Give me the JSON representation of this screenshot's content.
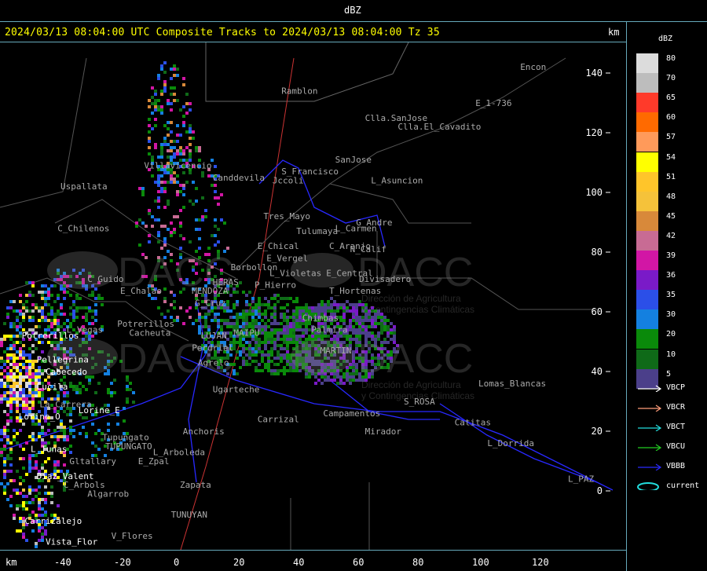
{
  "header": {
    "title": "dBZ"
  },
  "subtitle": {
    "text": "2024/03/13 08:04:00 UTC Composite Tracks to 2024/03/13 08:04:00 Tz 35",
    "unit": "km"
  },
  "axes": {
    "x_unit": "km",
    "x_ticks": [
      "-40",
      "-20",
      "0",
      "20",
      "40",
      "60",
      "80",
      "100",
      "120"
    ],
    "y_ticks": [
      "140",
      "120",
      "100",
      "80",
      "60",
      "40",
      "20",
      "0"
    ]
  },
  "legend": {
    "title": "dBZ",
    "scale": [
      {
        "label": "80",
        "color": "#dcdcdc"
      },
      {
        "label": "70",
        "color": "#bdbdbd"
      },
      {
        "label": "65",
        "color": "#ff3a2a"
      },
      {
        "label": "60",
        "color": "#ff6a00"
      },
      {
        "label": "57",
        "color": "#ff9a5a"
      },
      {
        "label": "54",
        "color": "#ffff00"
      },
      {
        "label": "51",
        "color": "#ffc52a"
      },
      {
        "label": "48",
        "color": "#f5c23a"
      },
      {
        "label": "45",
        "color": "#d8893a"
      },
      {
        "label": "42",
        "color": "#c86b94"
      },
      {
        "label": "39",
        "color": "#d216a5"
      },
      {
        "label": "36",
        "color": "#7a1ac8"
      },
      {
        "label": "35",
        "color": "#2b4fe8"
      },
      {
        "label": "30",
        "color": "#1480e0"
      },
      {
        "label": "20",
        "color": "#0a8a0a"
      },
      {
        "label": "10",
        "color": "#0f6a18"
      },
      {
        "label": "5",
        "color": "#4b3f8a"
      }
    ],
    "tracks": [
      {
        "label": "VBCP",
        "color": "#ffffff"
      },
      {
        "label": "VBCR",
        "color": "#ff9c7a"
      },
      {
        "label": "VBCT",
        "color": "#22dddd"
      },
      {
        "label": "VBCU",
        "color": "#22cc22"
      },
      {
        "label": "VBBB",
        "color": "#2a2aff"
      },
      {
        "label": "current",
        "color": "#22dddd"
      }
    ]
  },
  "watermark": {
    "logo_text": "DACC",
    "line1": "Dirección de Agricultura",
    "line2": "y Contingencias Climáticas"
  },
  "places": [
    {
      "name": "Ramblon",
      "c": "#aaa",
      "km": [
        34,
        133
      ]
    },
    {
      "name": "Encon",
      "c": "#aaa",
      "km": [
        114,
        141
      ]
    },
    {
      "name": "E_1-736",
      "c": "#aaa",
      "km": [
        99,
        129
      ]
    },
    {
      "name": "Clla.SanJose",
      "c": "#aaa",
      "km": [
        62,
        124
      ]
    },
    {
      "name": "Clla.El_Cavadito",
      "c": "#aaa",
      "km": [
        73,
        121
      ]
    },
    {
      "name": "SanJose",
      "c": "#aaa",
      "km": [
        52,
        110
      ]
    },
    {
      "name": "S_Francisco",
      "c": "#aaa",
      "km": [
        34,
        106
      ]
    },
    {
      "name": "Jccoli",
      "c": "#aaa",
      "km": [
        31,
        103
      ]
    },
    {
      "name": "L_Asuncion",
      "c": "#aaa",
      "km": [
        64,
        103
      ]
    },
    {
      "name": "Villavicencio",
      "c": "#aaa",
      "km": [
        -12,
        108
      ]
    },
    {
      "name": "Canddevila",
      "c": "#aaa",
      "km": [
        11,
        104
      ]
    },
    {
      "name": "Uspallata",
      "c": "#aaa",
      "km": [
        -40,
        101
      ]
    },
    {
      "name": "Tres_Mayo",
      "c": "#aaa",
      "km": [
        28,
        91
      ]
    },
    {
      "name": "G_Andre",
      "c": "#aaa",
      "km": [
        59,
        89
      ]
    },
    {
      "name": "Tulumaya",
      "c": "#aaa",
      "km": [
        39,
        86
      ]
    },
    {
      "name": "L_Carmen",
      "c": "#aaa",
      "km": [
        52,
        87
      ]
    },
    {
      "name": "C_Chilenos",
      "c": "#aaa",
      "km": [
        -41,
        87
      ]
    },
    {
      "name": "E_Chical",
      "c": "#aaa",
      "km": [
        26,
        81
      ]
    },
    {
      "name": "C_Aranjo",
      "c": "#aaa",
      "km": [
        50,
        81
      ]
    },
    {
      "name": "N_Calif",
      "c": "#aaa",
      "km": [
        57,
        80
      ]
    },
    {
      "name": "E_Vergel",
      "c": "#aaa",
      "km": [
        29,
        77
      ]
    },
    {
      "name": "Borbollon",
      "c": "#aaa",
      "km": [
        17,
        74
      ]
    },
    {
      "name": "L_Violetas",
      "c": "#aaa",
      "km": [
        30,
        72
      ]
    },
    {
      "name": "E_Central",
      "c": "#aaa",
      "km": [
        49,
        72
      ]
    },
    {
      "name": "Divisadero",
      "c": "#aaa",
      "km": [
        60,
        70
      ]
    },
    {
      "name": "C_Guido",
      "c": "#aaa",
      "km": [
        -31,
        70
      ]
    },
    {
      "name": "P_Hierro",
      "c": "#aaa",
      "km": [
        25,
        68
      ]
    },
    {
      "name": "MENDOZA",
      "c": "#aaa",
      "km": [
        4,
        66
      ]
    },
    {
      "name": "HERAS",
      "c": "#aaa",
      "km": [
        11,
        69
      ]
    },
    {
      "name": "E_Chalao",
      "c": "#aaa",
      "km": [
        -20,
        66
      ]
    },
    {
      "name": "T_Hortenas",
      "c": "#aaa",
      "km": [
        50,
        66
      ]
    },
    {
      "name": "G_Cruz",
      "c": "#aaa",
      "km": [
        5,
        62
      ]
    },
    {
      "name": "L_Vegas",
      "c": "#aaa",
      "km": [
        -38,
        53
      ]
    },
    {
      "name": "Potrerillos",
      "c": "#aaa",
      "km": [
        -21,
        55
      ]
    },
    {
      "name": "Cacheuta",
      "c": "#aaa",
      "km": [
        -17,
        52
      ]
    },
    {
      "name": "LUJAN",
      "c": "#aaa",
      "km": [
        7,
        51
      ]
    },
    {
      "name": "Perdriel",
      "c": "#aaa",
      "km": [
        4,
        47
      ]
    },
    {
      "name": "Agrelo",
      "c": "#aaa",
      "km": [
        6,
        42
      ]
    },
    {
      "name": "Ugarteche",
      "c": "#aaa",
      "km": [
        11,
        33
      ]
    },
    {
      "name": "MAIPU",
      "c": "#aaa",
      "km": [
        18,
        52
      ]
    },
    {
      "name": "MARTIN",
      "c": "#aaa",
      "km": [
        47,
        46
      ]
    },
    {
      "name": "Palmira",
      "c": "#aaa",
      "km": [
        44,
        53
      ]
    },
    {
      "name": "Chimbas",
      "c": "#aaa",
      "km": [
        41,
        57
      ]
    },
    {
      "name": "Anchoris",
      "c": "#aaa",
      "km": [
        1,
        19
      ]
    },
    {
      "name": "Carrizal",
      "c": "#aaa",
      "km": [
        26,
        23
      ]
    },
    {
      "name": "Campamentos",
      "c": "#aaa",
      "km": [
        48,
        25
      ]
    },
    {
      "name": "Mirador",
      "c": "#aaa",
      "km": [
        62,
        19
      ]
    },
    {
      "name": "S_ROSA",
      "c": "#aaa",
      "km": [
        75,
        29
      ]
    },
    {
      "name": "Lomas_Blancas",
      "c": "#aaa",
      "km": [
        100,
        35
      ]
    },
    {
      "name": "Catitas",
      "c": "#aaa",
      "km": [
        92,
        22
      ]
    },
    {
      "name": "L_Dorrida",
      "c": "#aaa",
      "km": [
        103,
        15
      ]
    },
    {
      "name": "L_PAZ",
      "c": "#aaa",
      "km": [
        130,
        3
      ]
    },
    {
      "name": "Potrerillos",
      "c": "#fff",
      "km": [
        -53,
        51
      ]
    },
    {
      "name": "Pellegrina",
      "c": "#fff",
      "km": [
        -48,
        43
      ]
    },
    {
      "name": "Cabecedo",
      "c": "#fff",
      "km": [
        -45,
        39
      ]
    },
    {
      "name": "Lucila",
      "c": "#fff",
      "km": [
        -48,
        34
      ]
    },
    {
      "name": "La_Carrera",
      "c": "#aaa",
      "km": [
        -47,
        28
      ]
    },
    {
      "name": "Lorine_E",
      "c": "#fff",
      "km": [
        -34,
        26
      ]
    },
    {
      "name": "Lorine_O",
      "c": "#fff",
      "km": [
        -54,
        24
      ]
    },
    {
      "name": "Tupungato",
      "c": "#aaa",
      "km": [
        -26,
        17
      ]
    },
    {
      "name": "TUPUNGATO",
      "c": "#aaa",
      "km": [
        -25,
        14
      ]
    },
    {
      "name": "L_Arboleda",
      "c": "#aaa",
      "km": [
        -9,
        12
      ]
    },
    {
      "name": "L_Tunas",
      "c": "#fff",
      "km": [
        -50,
        13
      ]
    },
    {
      "name": "Gltallary",
      "c": "#aaa",
      "km": [
        -37,
        9
      ]
    },
    {
      "name": "E_Zpal",
      "c": "#aaa",
      "km": [
        -14,
        9
      ]
    },
    {
      "name": "Diaz_Valent",
      "c": "#fff",
      "km": [
        -48,
        4
      ]
    },
    {
      "name": "C_Arbols",
      "c": "#aaa",
      "km": [
        -39,
        1
      ]
    },
    {
      "name": "Algarrob",
      "c": "#aaa",
      "km": [
        -31,
        -2
      ]
    },
    {
      "name": "Zapata",
      "c": "#aaa",
      "km": [
        0,
        1
      ]
    },
    {
      "name": "TUNUYAN",
      "c": "#aaa",
      "km": [
        -3,
        -9
      ]
    },
    {
      "name": "Carrizalejo",
      "c": "#fff",
      "km": [
        -52,
        -11
      ]
    },
    {
      "name": "Vista_Flor",
      "c": "#fff",
      "km": [
        -45,
        -18
      ]
    },
    {
      "name": "V_Flores",
      "c": "#aaa",
      "km": [
        -23,
        -16
      ]
    }
  ]
}
